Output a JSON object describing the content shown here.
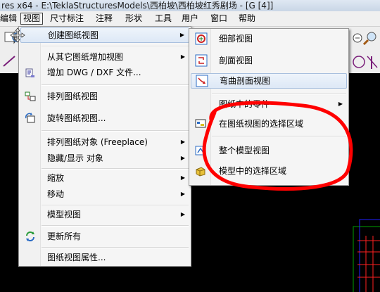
{
  "window": {
    "title": "res x64 - E:\\TeklaStructuresModels\\西柏坡\\西柏坡红秀剧场 - [G    [4]]"
  },
  "menubar": {
    "items": [
      "编辑",
      "视图",
      "尺寸标注",
      "注释",
      "形状",
      "工具",
      "用户",
      "窗口",
      "帮助"
    ],
    "active": "视图"
  },
  "view_menu": {
    "items": [
      {
        "label": "创建图纸视图",
        "submenu": true,
        "highlighted": true,
        "icon": "move-view-icon"
      },
      {
        "label": "从其它图纸增加视图",
        "submenu": true,
        "icon": ""
      },
      {
        "label": "增加 DWG / DXF 文件...",
        "submenu": false,
        "icon": "dwg-file-icon"
      },
      {
        "label": "排列图纸视图",
        "submenu": false,
        "icon": "arrange-views-icon"
      },
      {
        "label": "旋转图纸视图...",
        "submenu": false,
        "icon": "rotate-view-icon"
      },
      {
        "label": "排列图纸对象 (Freeplace)",
        "submenu": true,
        "icon": ""
      },
      {
        "label": "隐藏/显示 对象",
        "submenu": true,
        "icon": ""
      },
      {
        "label": "缩放",
        "submenu": true,
        "icon": ""
      },
      {
        "label": "移动",
        "submenu": true,
        "icon": ""
      },
      {
        "label": "模型视图",
        "submenu": true,
        "icon": ""
      },
      {
        "label": "更新所有",
        "submenu": false,
        "icon": "update-all-icon"
      },
      {
        "label": "图纸视图属性...",
        "submenu": false,
        "icon": ""
      }
    ]
  },
  "create_view_submenu": {
    "items": [
      {
        "label": "细部视图",
        "submenu": false,
        "icon": "detail-view-icon"
      },
      {
        "label": "剖面视图",
        "submenu": false,
        "icon": "section-view-icon"
      },
      {
        "label": "弯曲剖面视图",
        "submenu": false,
        "icon": "curved-section-view-icon",
        "highlighted": true
      },
      {
        "label": "图纸中的零件",
        "submenu": true,
        "icon": ""
      },
      {
        "label": "在图纸视图的选择区域",
        "submenu": false,
        "icon": "area-in-view-icon"
      },
      {
        "label": "整个模型视图",
        "submenu": false,
        "icon": "whole-model-view-icon"
      },
      {
        "label": "模型中的选择区域",
        "submenu": false,
        "icon": "area-in-model-icon"
      }
    ]
  },
  "colors": {
    "annotation": "#ff0000",
    "highlight_border": "#a9c0de",
    "canvas": "#000000"
  }
}
